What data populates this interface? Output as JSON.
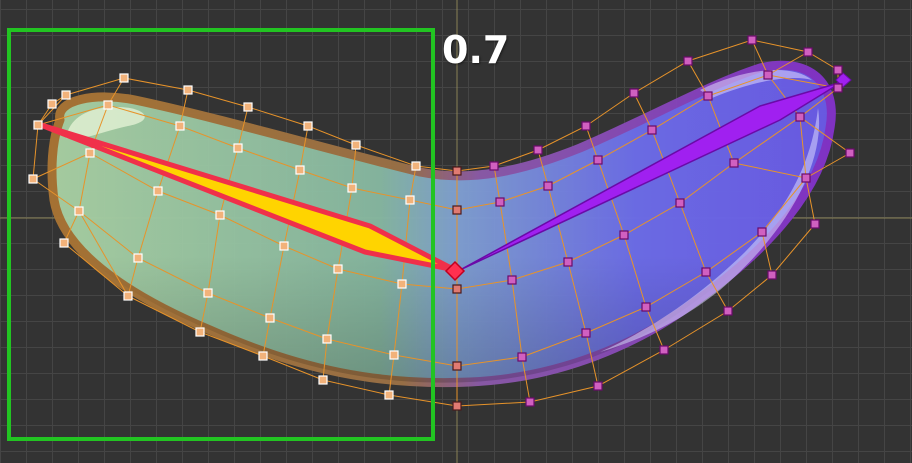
{
  "viewport": {
    "weight_value": "0.7"
  },
  "colors": {
    "grid_background": "#333333",
    "grid_line": "#454545",
    "axis_line": "#8a8256",
    "selection_box": "#22c422",
    "mesh_line": "#e7932a",
    "left_vertex": "#f2b27a",
    "left_vertex_border": "#ffffff",
    "middle_vertex": "#e07a72",
    "right_vertex": "#d060c0",
    "right_vertex_border": "#6a0a6a",
    "shape_outline": "#b07a38",
    "shape_fill_left": "#8fc39a",
    "shape_fill_right": "#6a62e6",
    "shape_outline_right": "#7c34c8",
    "bone_left": "#ffd400",
    "bone_left_outline": "#f0304a",
    "bone_right": "#a020f0",
    "bone_right_outline": "#6a0aa8",
    "joint": "#ff3050"
  },
  "icons": {
    "selected_bone": "bone-icon",
    "unselected_bone": "bone-icon",
    "vertex": "vertex-handle-icon",
    "joint": "joint-icon"
  }
}
